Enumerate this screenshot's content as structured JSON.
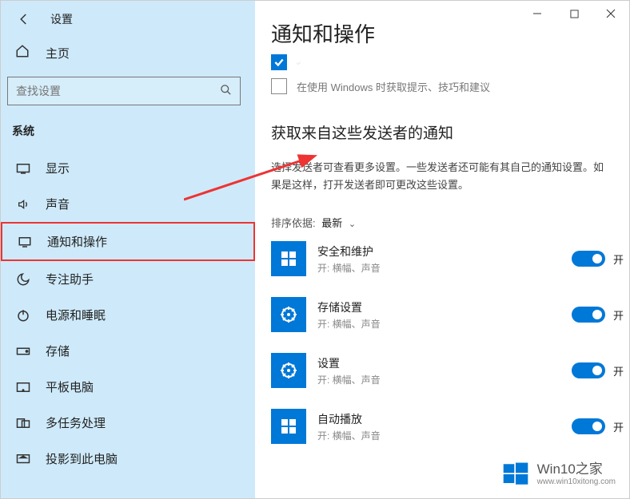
{
  "app": {
    "title": "设置"
  },
  "sidebar": {
    "home": "主页",
    "search_placeholder": "查找设置",
    "section": "系统",
    "items": [
      {
        "label": "显示"
      },
      {
        "label": "声音"
      },
      {
        "label": "通知和操作"
      },
      {
        "label": "专注助手"
      },
      {
        "label": "电源和睡眠"
      },
      {
        "label": "存储"
      },
      {
        "label": "平板电脑"
      },
      {
        "label": "多任务处理"
      },
      {
        "label": "投影到此电脑"
      }
    ]
  },
  "main": {
    "title": "通知和操作",
    "check_unchecked": "在使用 Windows 时获取提示、技巧和建议",
    "sub_title": "获取来自这些发送者的通知",
    "description": "选择发送者可查看更多设置。一些发送者还可能有其自己的通知设置。如果是这样，打开发送者即可更改这些设置。",
    "sort_label": "排序依据:",
    "sort_value": "最新",
    "senders": [
      {
        "name": "安全和维护",
        "sub": "开: 横幅、声音",
        "state": "开"
      },
      {
        "name": "存储设置",
        "sub": "开: 横幅、声音",
        "state": "开"
      },
      {
        "name": "设置",
        "sub": "开: 横幅、声音",
        "state": "开"
      },
      {
        "name": "自动播放",
        "sub": "开: 横幅、声音",
        "state": "开"
      }
    ]
  },
  "watermark": {
    "main": "Win10之家",
    "sub": "www.win10xitong.com"
  }
}
